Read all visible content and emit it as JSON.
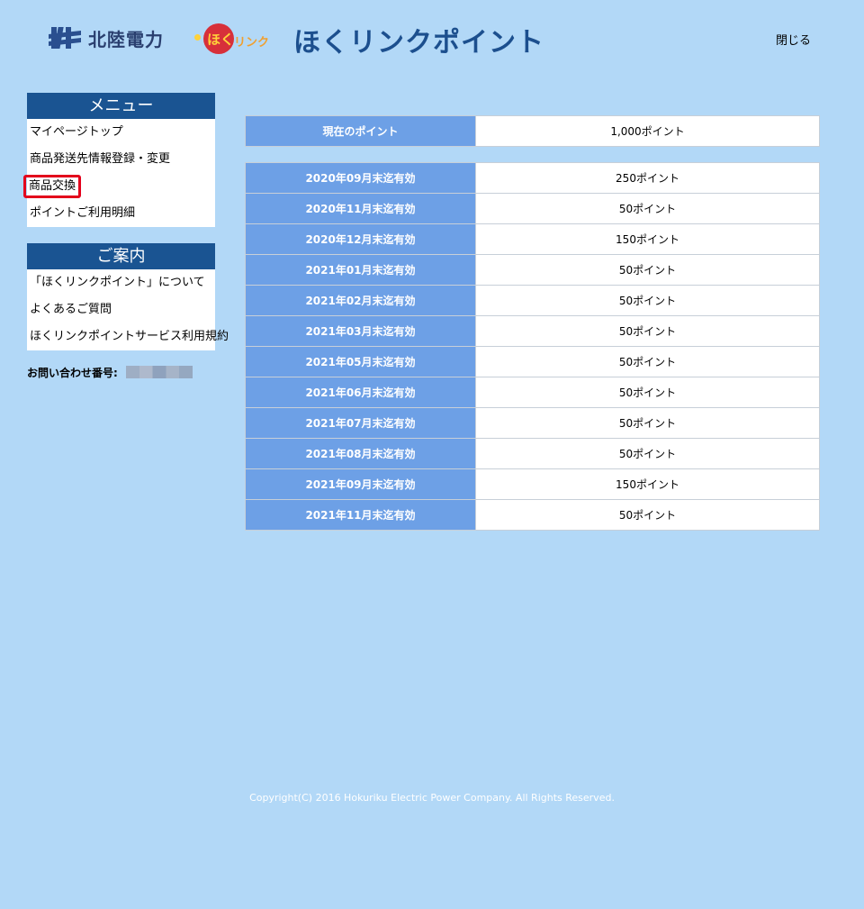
{
  "header": {
    "brand": "北陸電力",
    "badge_hoku": "ほく",
    "badge_link": "リンク",
    "site_title": "ほくリンクポイント",
    "close_label": "閉じる"
  },
  "menu": {
    "title": "メニュー",
    "items": [
      {
        "label": "マイページトップ"
      },
      {
        "label": "商品発送先情報登録・変更"
      },
      {
        "label": "商品交換"
      },
      {
        "label": "ポイントご利用明細"
      }
    ]
  },
  "guide": {
    "title": "ご案内",
    "items": [
      {
        "label": "「ほくリンクポイント」について"
      },
      {
        "label": "よくあるご質問"
      },
      {
        "label": "ほくリンクポイントサービス利用規約"
      }
    ]
  },
  "contact_label": "お問い合わせ番号:",
  "current_points": {
    "label": "現在のポイント",
    "value": "1,000ポイント"
  },
  "expiry_rows": [
    {
      "label": "2020年09月末迄有効",
      "value": "250ポイント"
    },
    {
      "label": "2020年11月末迄有効",
      "value": "50ポイント"
    },
    {
      "label": "2020年12月末迄有効",
      "value": "150ポイント"
    },
    {
      "label": "2021年01月末迄有効",
      "value": "50ポイント"
    },
    {
      "label": "2021年02月末迄有効",
      "value": "50ポイント"
    },
    {
      "label": "2021年03月末迄有効",
      "value": "50ポイント"
    },
    {
      "label": "2021年05月末迄有効",
      "value": "50ポイント"
    },
    {
      "label": "2021年06月末迄有効",
      "value": "50ポイント"
    },
    {
      "label": "2021年07月末迄有効",
      "value": "50ポイント"
    },
    {
      "label": "2021年08月末迄有効",
      "value": "50ポイント"
    },
    {
      "label": "2021年09月末迄有効",
      "value": "150ポイント"
    },
    {
      "label": "2021年11月末迄有効",
      "value": "50ポイント"
    }
  ],
  "footer": {
    "copyright": "Copyright(C) 2016 Hokuriku Electric Power Company. All Rights Reserved."
  }
}
